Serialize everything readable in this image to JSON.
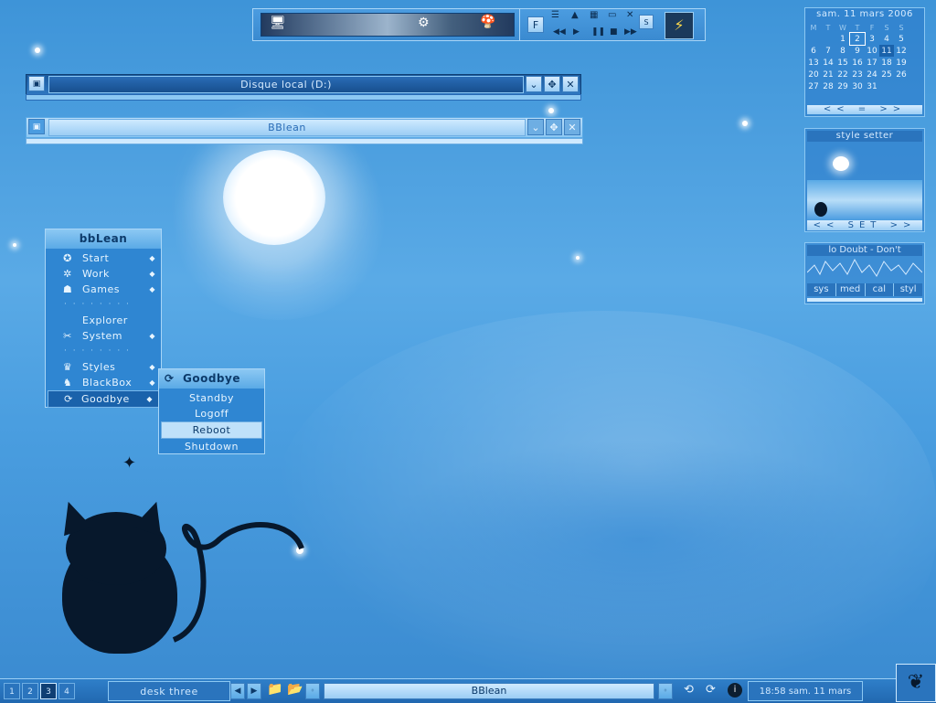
{
  "desktop": {
    "toolbar_top": {
      "f_label": "F",
      "s_label": "S"
    },
    "window1": {
      "title": "Disque local (D:)"
    },
    "window2": {
      "title": "BBlean"
    },
    "menu": {
      "title": "bbLean",
      "items": [
        {
          "label": "Start",
          "icon": "start-icon",
          "arrow": true
        },
        {
          "label": "Work",
          "icon": "work-icon",
          "arrow": true
        },
        {
          "label": "Games",
          "icon": "games-icon",
          "arrow": true
        },
        {
          "sep": true
        },
        {
          "label": "Explorer",
          "icon": "",
          "arrow": false
        },
        {
          "label": "System",
          "icon": "tools-icon",
          "arrow": true
        },
        {
          "sep": true
        },
        {
          "label": "Styles",
          "icon": "styles-icon",
          "arrow": true
        },
        {
          "label": "BlackBox",
          "icon": "blackbox-icon",
          "arrow": true
        },
        {
          "label": "Goodbye",
          "icon": "power-icon",
          "arrow": true,
          "selected": true
        }
      ]
    },
    "submenu": {
      "title": "Goodbye",
      "items": [
        "Standby",
        "Logoff",
        "Reboot",
        "Shutdown"
      ],
      "selected_index": 2
    },
    "calendar": {
      "header": "sam. 11 mars 2006",
      "weekdays": [
        "M",
        "T",
        "W",
        "T",
        "F",
        "S",
        "S"
      ],
      "weeks": [
        [
          "",
          "",
          "",
          "1",
          "2",
          "3",
          "4",
          "5"
        ],
        [
          "6",
          "7",
          "8",
          "9",
          "10",
          "11",
          "12"
        ],
        [
          "13",
          "14",
          "15",
          "16",
          "17",
          "18",
          "19"
        ],
        [
          "20",
          "21",
          "22",
          "23",
          "24",
          "25",
          "26"
        ],
        [
          "27",
          "28",
          "29",
          "30",
          "31",
          "",
          ""
        ]
      ],
      "prev": "<<",
      "mid": "=",
      "next": ">>",
      "today": "11",
      "boxed": "2"
    },
    "style_setter": {
      "label": "style setter",
      "prev": "<<",
      "set": "SET",
      "next": ">>"
    },
    "media": {
      "track": "lo Doubt - Don't",
      "tabs": [
        "sys",
        "med",
        "cal",
        "styl"
      ]
    },
    "taskbar": {
      "workspaces": [
        "1",
        "2",
        "3",
        "4"
      ],
      "active_ws": "3",
      "desk_name": "desk three",
      "task": "BBlean",
      "clock": "18:58 sam. 11 mars"
    }
  }
}
